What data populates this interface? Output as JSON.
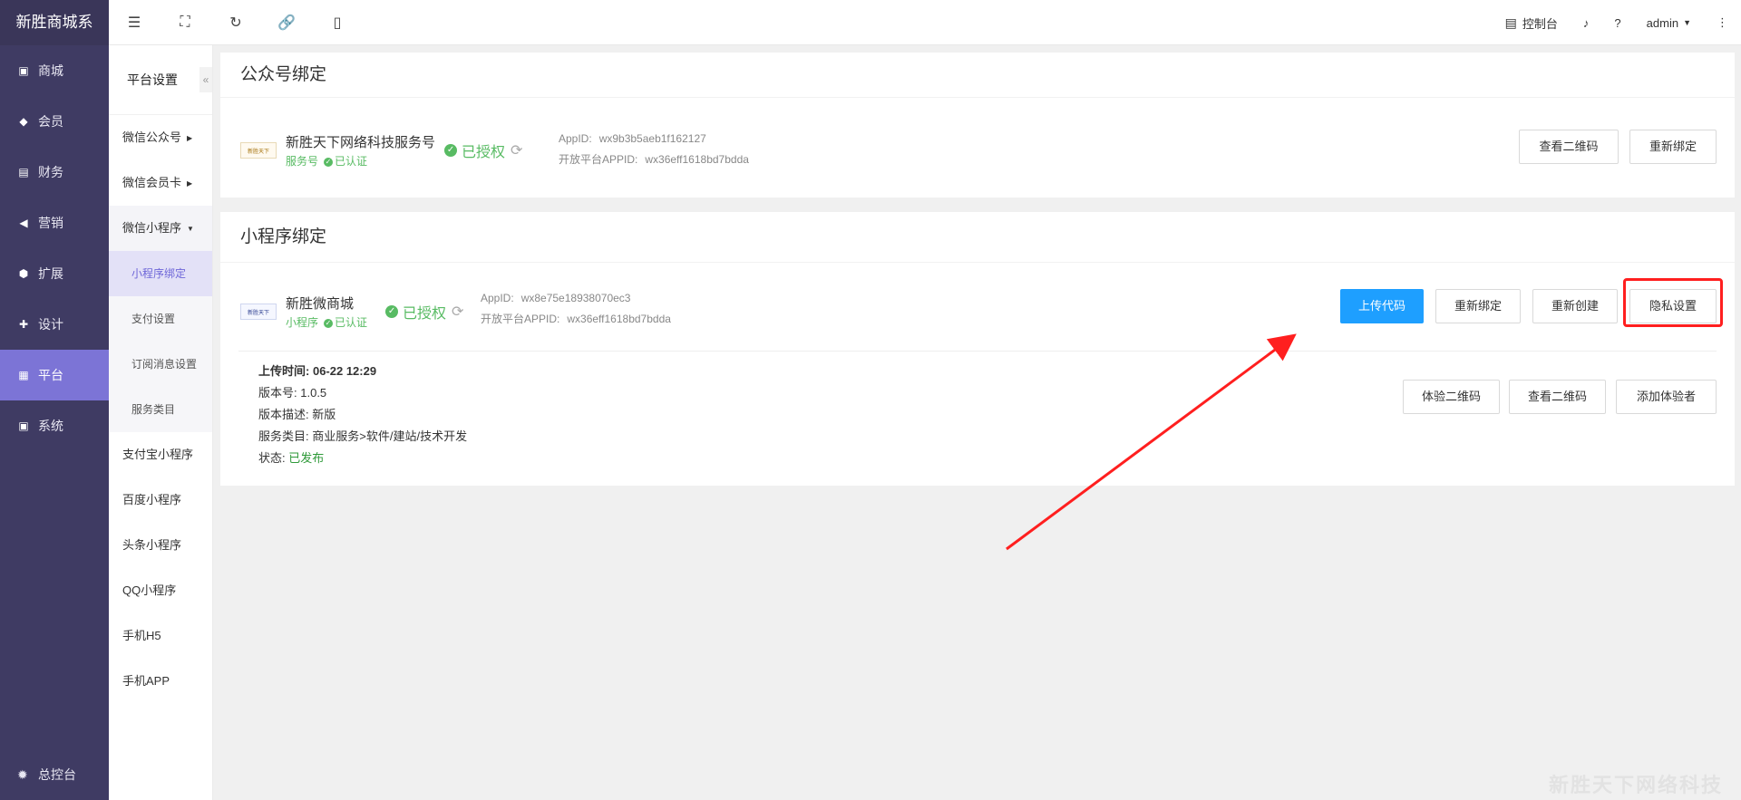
{
  "brand": "新胜商城系",
  "sidebar": {
    "items": [
      {
        "label": "商城",
        "icon": "shop-icon"
      },
      {
        "label": "会员",
        "icon": "member-icon"
      },
      {
        "label": "财务",
        "icon": "finance-icon"
      },
      {
        "label": "营销",
        "icon": "megaphone-icon"
      },
      {
        "label": "扩展",
        "icon": "cube-icon"
      },
      {
        "label": "设计",
        "icon": "puzzle-icon"
      },
      {
        "label": "平台",
        "icon": "grid-icon"
      },
      {
        "label": "系统",
        "icon": "monitor-icon"
      }
    ],
    "bottom": "总控台"
  },
  "subsidebar": {
    "title": "平台设置",
    "items": [
      "微信公众号",
      "微信会员卡",
      "微信小程序",
      "小程序绑定",
      "支付设置",
      "订阅消息设置",
      "服务类目",
      "支付宝小程序",
      "百度小程序",
      "头条小程序",
      "QQ小程序",
      "手机H5",
      "手机APP"
    ]
  },
  "topbar": {
    "console": "控制台",
    "user": "admin"
  },
  "gzh": {
    "title": "公众号绑定",
    "logo_text": "新胜天下",
    "name": "新胜天下网络科技服务号",
    "type": "服务号",
    "verified": "已认证",
    "auth": "已授权",
    "appid_label": "AppID:",
    "appid": "wx9b3b5aeb1f162127",
    "open_label": "开放平台APPID:",
    "open_appid": "wx36eff1618bd7bdda",
    "btn_qr": "查看二维码",
    "btn_rebind": "重新绑定"
  },
  "mp": {
    "title": "小程序绑定",
    "logo_text": "新胜天下",
    "name": "新胜微商城",
    "type": "小程序",
    "verified": "已认证",
    "auth": "已授权",
    "appid_label": "AppID:",
    "appid": "wx8e75e18938070ec3",
    "open_label": "开放平台APPID:",
    "open_appid": "wx36eff1618bd7bdda",
    "btn_upload": "上传代码",
    "btn_rebind": "重新绑定",
    "btn_recreate": "重新创建",
    "btn_privacy": "隐私设置",
    "upload_time_label": "上传时间:",
    "upload_time": "06-22 12:29",
    "version_label": "版本号:",
    "version": "1.0.5",
    "desc_label": "版本描述:",
    "desc": "新版",
    "category_label": "服务类目:",
    "category": "商业服务>软件/建站/技术开发",
    "status_label": "状态:",
    "status": "已发布",
    "btn_trial_qr": "体验二维码",
    "btn_view_qr": "查看二维码",
    "btn_add_tester": "添加体验者"
  },
  "watermark": "新胜天下网络科技",
  "colors": {
    "sidebar": "#3f3b63",
    "accent": "#7c74d6",
    "primary_button": "#1e9fff",
    "success": "#58bb63",
    "annotation": "#ff1f1f"
  }
}
